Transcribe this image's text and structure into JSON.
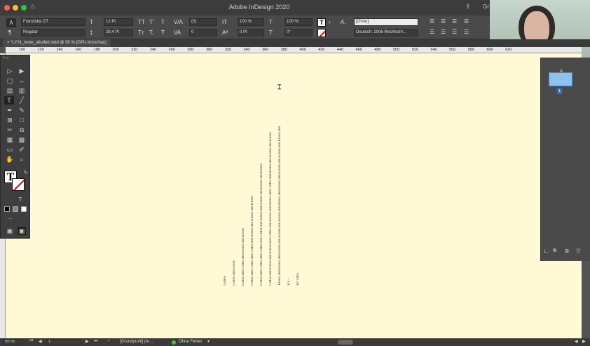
{
  "window": {
    "title": "Adobe InDesign 2020",
    "right_label": "Gr"
  },
  "control": {
    "font_family": "Franziska OT",
    "font_style": "Regular",
    "font_size": "12 Pt",
    "leading": "28,4 Pt",
    "kerning": "(0)",
    "tracking": "0",
    "vertical_scale": "100 %",
    "horizontal_scale": "100 %",
    "baseline_shift": "0 Pt",
    "skew": "0°",
    "char_style": "[Ohne]",
    "language": "Deutsch: 2006 Rechtschr..."
  },
  "tab": {
    "label": "*LY01_texte_ultrafett.indd @ 50 % [GPU-Vorschau]"
  },
  "ruler": {
    "ticks": [
      "100",
      "120",
      "140",
      "160",
      "180",
      "200",
      "220",
      "240",
      "260",
      "280",
      "300",
      "320",
      "340",
      "360",
      "380",
      "400",
      "420",
      "440",
      "460",
      "480",
      "500",
      "520",
      "540",
      "560",
      "580",
      "600",
      "620"
    ]
  },
  "text_lines": [
    "Coffee",
    "Coffee and Kisses",
    "Coffee and Coffee and Kisses and Kisses",
    "Coffee and Coffee and Coffee and Kisses and Kisses and Kisses",
    "Coffee and Coffee and Coffee and Coffee and Kisses and Kisses and Kisses and Kisses",
    "Coffee and Kisses and Kisses and Coffee and Kisses and Kisses and Coffee and Kisses and Kisses and Kisses",
    "Kisses and Kisses and Kisses and Kisses and Kisses and Kisses and Kisses and Kisses and Kisses and Kisses and",
    "Flü -",
    "für Theo."
  ],
  "pages_panel": {
    "page_number": "1",
    "page_count_label": "1..."
  },
  "status": {
    "zoom": "50 %",
    "page": "1",
    "profile": "[Grundprofil] (Ar...",
    "errors": "Ohne Fehler"
  }
}
